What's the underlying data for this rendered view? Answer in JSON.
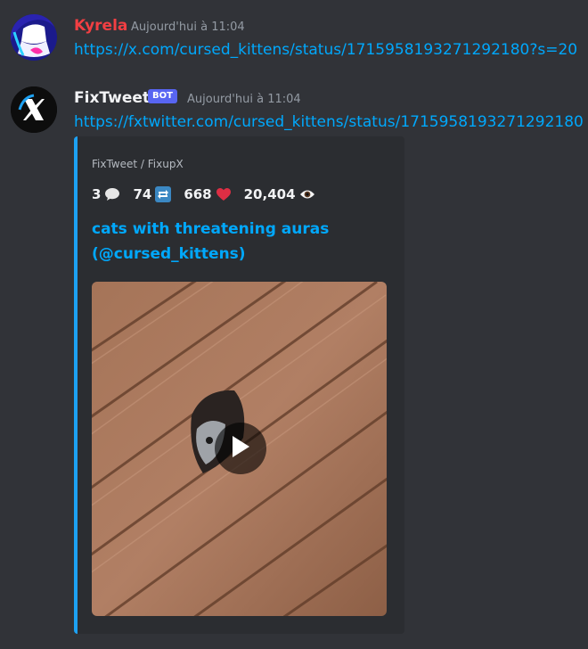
{
  "messages": [
    {
      "username": "Kyrela",
      "username_color": "#f23f43",
      "timestamp": "Aujourd'hui à 11:04",
      "link": "https://x.com/cursed_kittens/status/1715958193271292180?s=20"
    },
    {
      "username": "FixTweet",
      "username_color": "#f2f3f5",
      "badge": "BOT",
      "timestamp": "Aujourd'hui à 11:04",
      "link": "https://fxtwitter.com/cursed_kittens/status/1715958193271292180",
      "embed": {
        "accent_color": "#1da1f2",
        "provider": "FixTweet / FixupX",
        "stats": {
          "replies": "3",
          "retweets": "74",
          "likes": "668",
          "views": "20,404"
        },
        "title": "cats with threatening auras (@cursed_kittens)",
        "media": {
          "type": "video",
          "icon": "play-icon"
        }
      }
    }
  ]
}
